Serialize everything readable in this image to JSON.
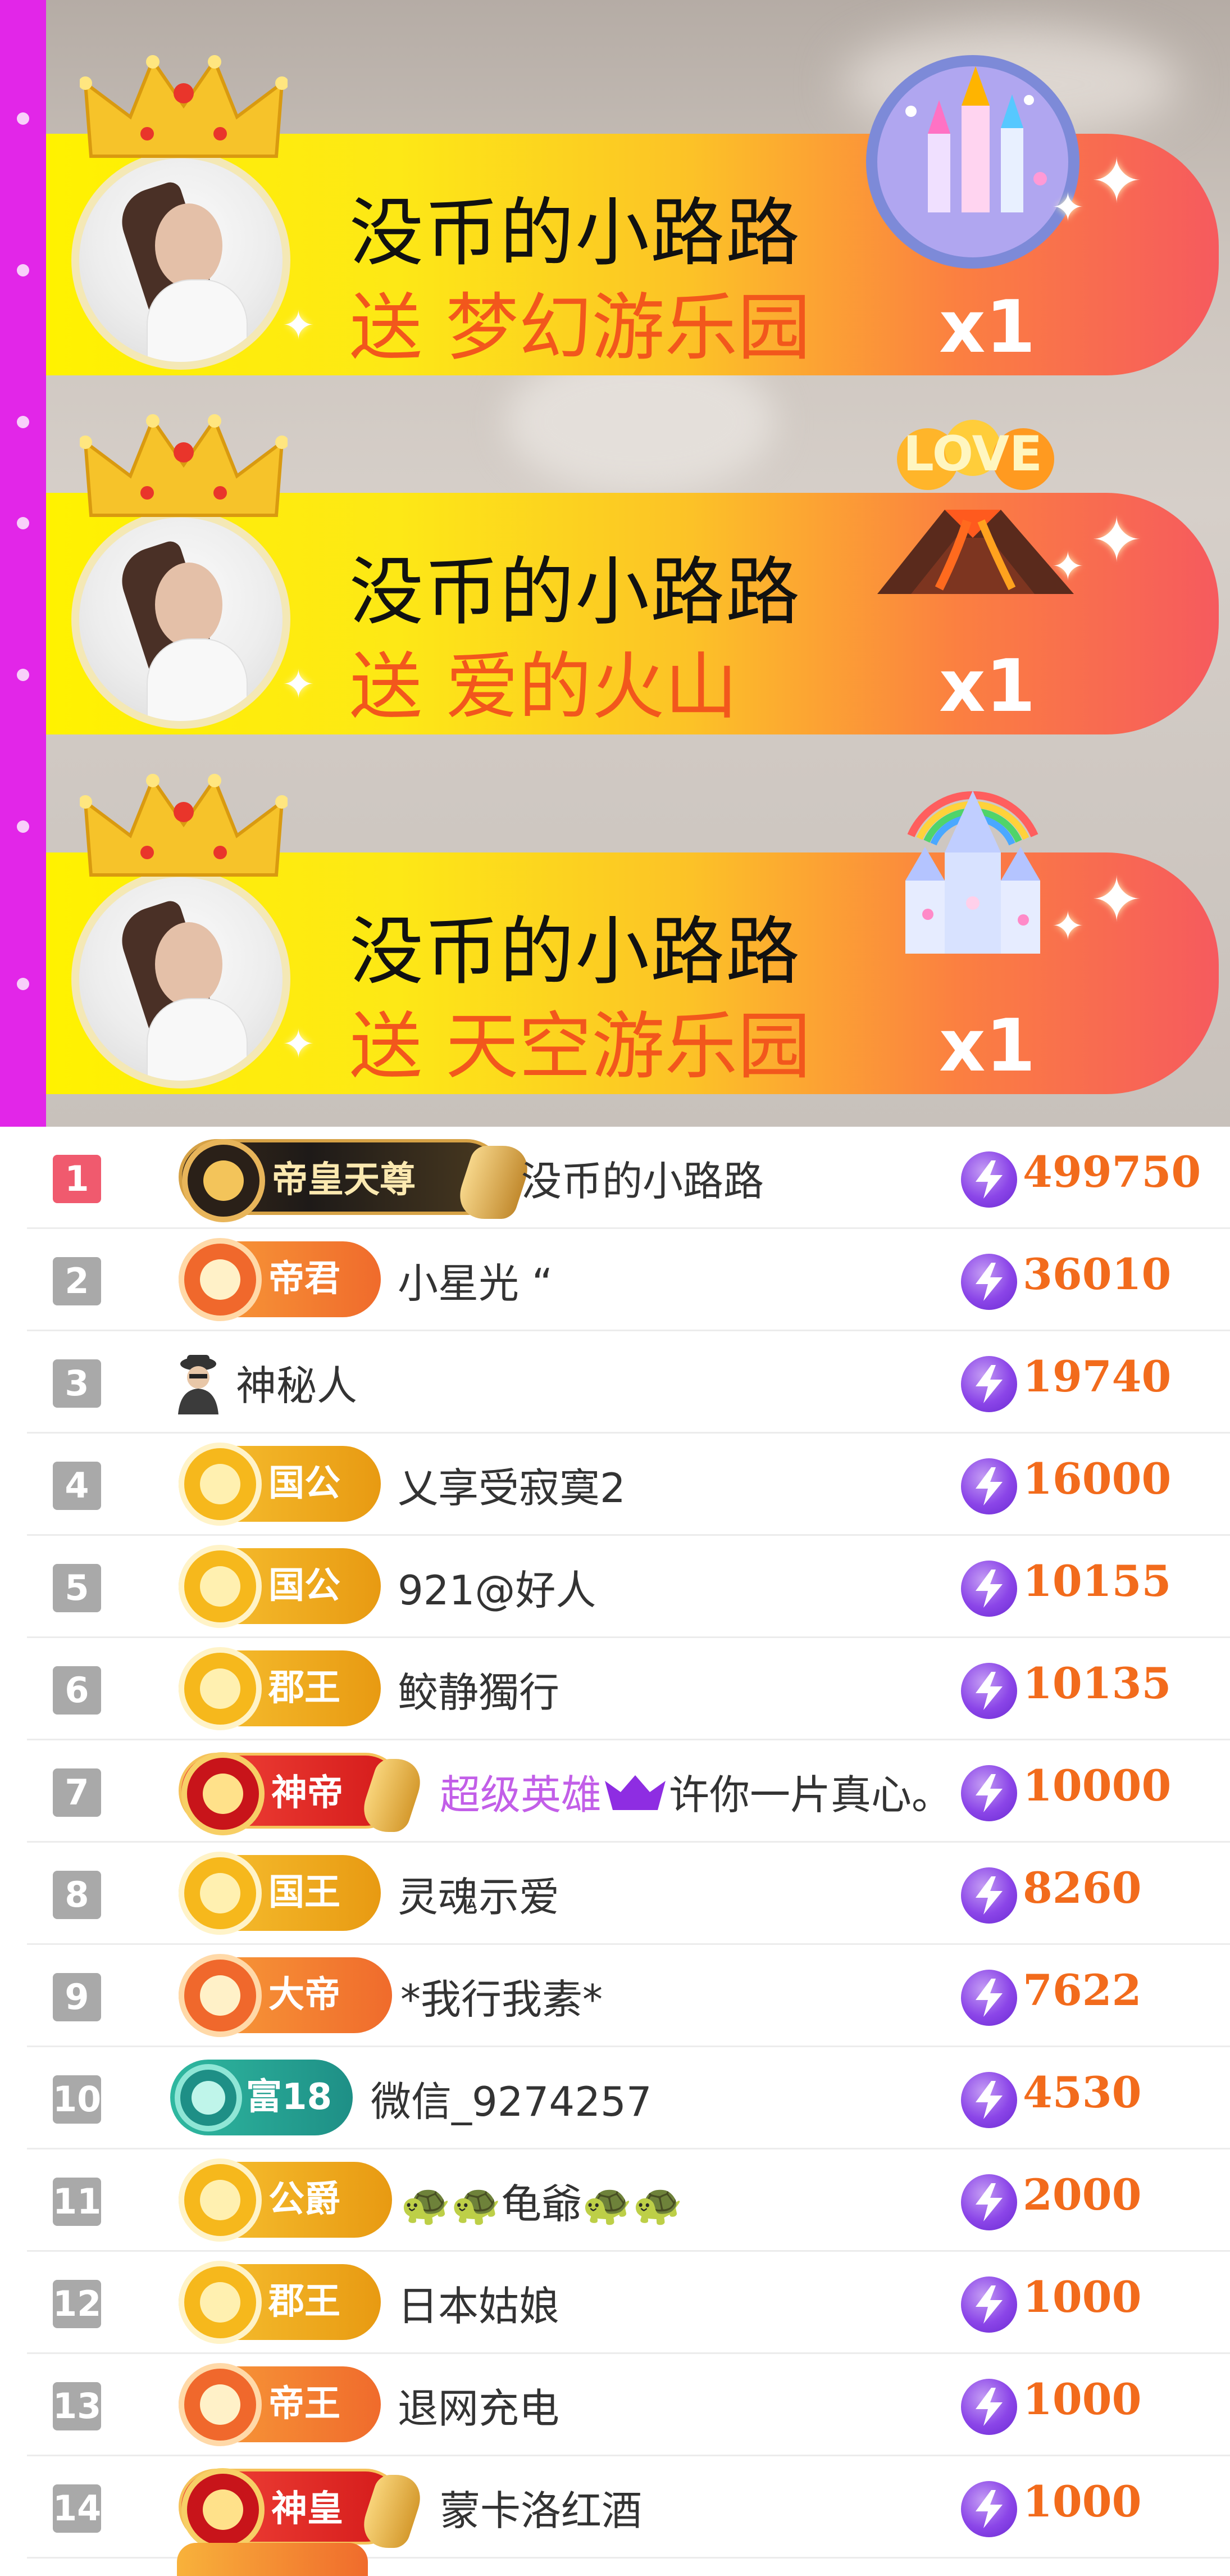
{
  "colors": {
    "accent_pink_strip": "#e226e8",
    "banner_gradient": [
      "#fff200",
      "#fcc227",
      "#f65a5e"
    ],
    "gift_text": "#f2571c",
    "score_orange": "#f26b1c",
    "coin_purple": "#8b45e8",
    "rank1_red": "#f05a6e",
    "rank_gray": "#a9a9a9"
  },
  "gift_banners": [
    {
      "sender": "没币的小路路",
      "gift_text": "送 梦幻游乐园",
      "count": "x1",
      "gift_icon": "dream-amusement-park-icon"
    },
    {
      "sender": "没币的小路路",
      "gift_text": "送 爱的火山",
      "count": "x1",
      "gift_icon": "love-volcano-icon"
    },
    {
      "sender": "没币的小路路",
      "gift_text": "送 天空游乐园",
      "count": "x1",
      "gift_icon": "sky-amusement-park-icon"
    }
  ],
  "ranking": [
    {
      "rank": "1",
      "badge": "帝皇天尊",
      "badge_style": "black-gold",
      "name": "没币的小路路",
      "score": "499750"
    },
    {
      "rank": "2",
      "badge": "帝君",
      "badge_style": "orange",
      "name": "小星光 “",
      "score": "36010"
    },
    {
      "rank": "3",
      "badge": "",
      "badge_style": "mystery",
      "name": "神秘人",
      "score": "19740"
    },
    {
      "rank": "4",
      "badge": "国公",
      "badge_style": "gold",
      "name": "乂享受寂寞2",
      "score": "16000"
    },
    {
      "rank": "5",
      "badge": "国公",
      "badge_style": "gold",
      "name": "921@好人",
      "score": "10155"
    },
    {
      "rank": "6",
      "badge": "郡王",
      "badge_style": "gold",
      "name": "鲛静獨行",
      "score": "10135"
    },
    {
      "rank": "7",
      "badge": "神帝",
      "badge_style": "red",
      "name_prefix": "超级英雄",
      "name_suffix": "许你一片真心。",
      "score": "10000"
    },
    {
      "rank": "8",
      "badge": "国王",
      "badge_style": "gold",
      "name": "灵魂示爱",
      "score": "8260"
    },
    {
      "rank": "9",
      "badge": "大帝",
      "badge_style": "orange",
      "name": "*我行我素*",
      "score": "7622"
    },
    {
      "rank": "10",
      "badge": "富18",
      "badge_style": "teal",
      "name": "微信_9274257",
      "score": "4530"
    },
    {
      "rank": "11",
      "badge": "公爵",
      "badge_style": "gold",
      "name": "🐢🐢龟爺🐢🐢",
      "score": "2000"
    },
    {
      "rank": "12",
      "badge": "郡王",
      "badge_style": "gold",
      "name": "日本姑娘",
      "score": "1000"
    },
    {
      "rank": "13",
      "badge": "帝王",
      "badge_style": "orange",
      "name": "退网充电",
      "score": "1000"
    },
    {
      "rank": "14",
      "badge": "神皇",
      "badge_style": "red",
      "name": "蒙卡洛红酒",
      "score": "1000"
    }
  ]
}
